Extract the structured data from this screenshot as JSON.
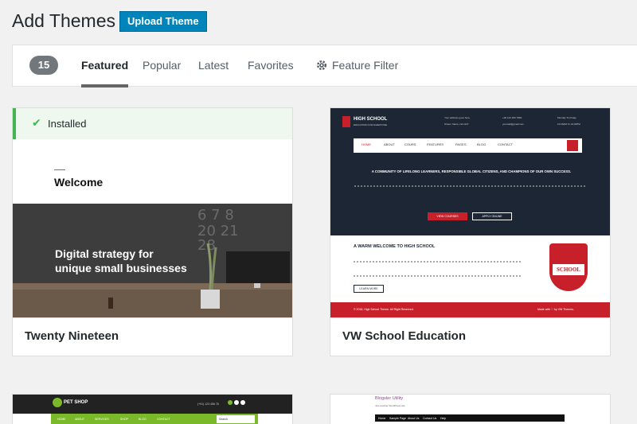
{
  "header": {
    "title": "Add Themes",
    "upload_label": "Upload Theme"
  },
  "filter": {
    "count": "15",
    "tabs": [
      "Featured",
      "Popular",
      "Latest",
      "Favorites"
    ],
    "active_tab": "Featured",
    "feature_filter_label": "Feature Filter"
  },
  "themes": [
    {
      "name": "Twenty Nineteen",
      "installed_label": "Installed",
      "preview": {
        "welcome": "Welcome",
        "tagline": "Digital strategy for\nunique small businesses"
      }
    },
    {
      "name": "VW School Education",
      "preview": {
        "logo": "HIGH SCHOOL",
        "logo_sub": "EDUCATION FOR EVERYONE",
        "address1": "Your address goes here,",
        "address2": "Street, Name, NA 1137",
        "phone": "+00 123 456 7890",
        "email": "youmail@gmail.com",
        "hours1": "Monday To Friday",
        "hours2": "10:00AM To 04:20PM",
        "nav": [
          "HOME",
          "ABOUT",
          "COURS",
          "FEATURES",
          "PAGES",
          "BLOG",
          "CONTACT"
        ],
        "hero": "A COMMUNITY OF LIFELONG LEARNERS, RESPONSIBLE GLOBAL CITIZENS, AND CHAMPIONS OF OUR OWN SUCCESS.",
        "btn1": "VIEW COURSES",
        "btn2": "APPLY ONLINE",
        "welcome_heading": "A WARM WELCOME TO HIGH SCHOOL",
        "learn_more": "LEARN MORE",
        "badge": "SCHOOL",
        "footer_left": "© 2018, High School Theme. All Right Reserved.",
        "footer_right": "Made with ♡ by VW Themes."
      }
    },
    {
      "name": "",
      "preview": {
        "logo": "PET SHOP",
        "phone": "(+91) 123 456 78",
        "nav": [
          "HOME",
          "ABOUT",
          "SERVICES",
          "SHOP",
          "BLOG",
          "CONTACT"
        ],
        "search": "Search"
      }
    },
    {
      "name": "",
      "preview": {
        "title": "Blogster Utility",
        "sub": "Just another WordPress site",
        "nav": [
          "Home",
          "Sample Page",
          "About Us",
          "Contact Us",
          "Help"
        ]
      }
    }
  ],
  "colors": {
    "accent": "#0085ba",
    "installed": "#46b450",
    "school_red": "#c8202a",
    "pet_green": "#7ab929"
  }
}
